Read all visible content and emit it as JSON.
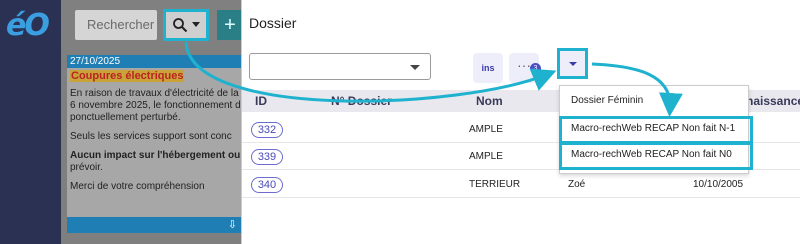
{
  "app": {
    "logo_text": "éO"
  },
  "toolbar": {
    "search_placeholder": "Rechercher",
    "plus_label": "+"
  },
  "news": {
    "date": "27/10/2025",
    "title": "Coupures électriques",
    "lines": [
      "En raison de travaux d'électricité de la",
      "6 novembre 2025, le fonctionnement d",
      "ponctuellement perturbé.",
      "Seuls les services support sont conc",
      "Aucun impact sur l'hébergement ou",
      "prévoir.",
      "Merci de votre compréhension"
    ],
    "scroll_icon": "⇩"
  },
  "modal": {
    "title": "Dossier",
    "ins_label": "ins",
    "more_label": "···",
    "more_badge": "3",
    "columns": {
      "id": "ID",
      "num": "N° Dossier",
      "nom": "Nom",
      "naissance": "naissance"
    },
    "rows": [
      {
        "id": "332",
        "nom": "AMPLE",
        "prenom": "",
        "date": ""
      },
      {
        "id": "339",
        "nom": "AMPLE",
        "prenom": "",
        "date": ""
      },
      {
        "id": "340",
        "nom": "TERRIEUR",
        "prenom": "Zoé",
        "date": "10/10/2005"
      }
    ]
  },
  "dropdown": {
    "items": [
      "Dossier Féminin",
      "Macro-rechWeb RECAP Non fait N-1",
      "Macro-rechWeb RECAP Non fait N0"
    ]
  },
  "colors": {
    "highlight": "#1fb2cf",
    "rail": "#2a3152",
    "accent": "#4b4fc4"
  }
}
